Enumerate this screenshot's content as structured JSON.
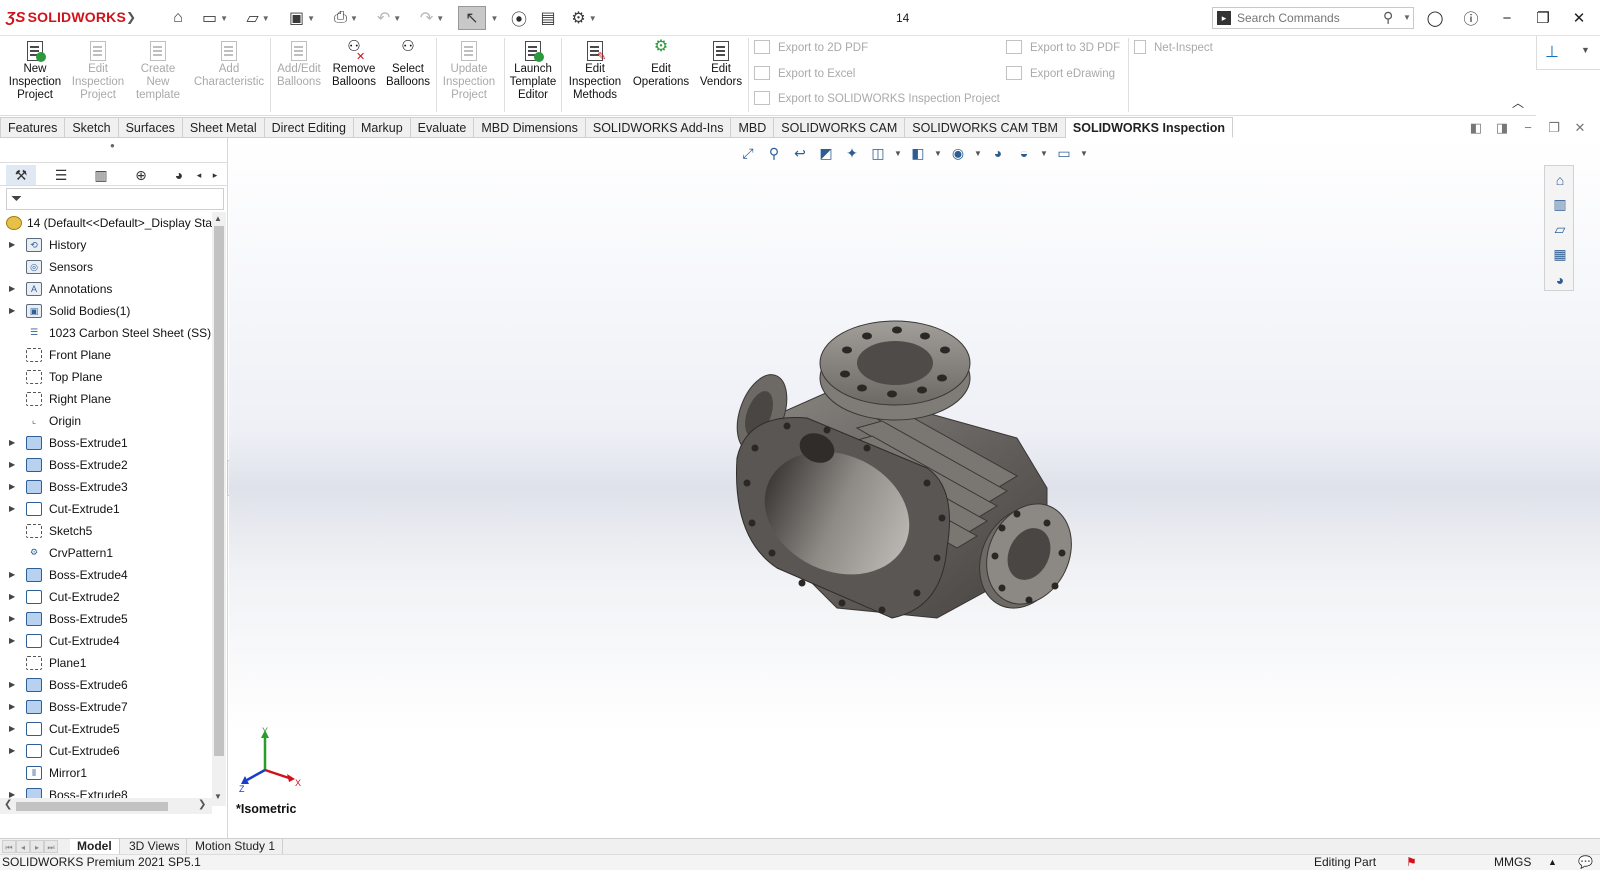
{
  "app": {
    "logo": "SOLIDWORKS",
    "document_title": "14",
    "search_placeholder": "Search Commands"
  },
  "colors": {
    "brand_red": "#d1121b",
    "icon_blue": "#2d5e93",
    "part_gray": "#6f6b67"
  },
  "quick_access": [
    {
      "name": "home-icon",
      "glyph": "⌂"
    },
    {
      "name": "new-document-icon",
      "glyph": "🗋"
    },
    {
      "name": "open-icon",
      "glyph": "📂"
    },
    {
      "name": "save-icon",
      "glyph": "💾"
    },
    {
      "name": "print-icon",
      "glyph": "🖶"
    },
    {
      "name": "undo-icon",
      "glyph": "↶"
    },
    {
      "name": "redo-icon",
      "glyph": "↷"
    },
    {
      "name": "select-icon",
      "glyph": "↖"
    },
    {
      "name": "rebuild-icon",
      "glyph": "🚦"
    },
    {
      "name": "file-properties-icon",
      "glyph": "▤"
    },
    {
      "name": "options-icon",
      "glyph": "⚙"
    }
  ],
  "commands": {
    "new_project": "New\nInspection\nProject",
    "edit_project": "Edit\nInspection\nProject",
    "create_template": "Create\nNew\ntemplate",
    "add_characteristic": "Add\nCharacteristic",
    "add_edit_balloons": "Add/Edit\nBalloons",
    "remove_balloons": "Remove\nBalloons",
    "select_balloons": "Select\nBalloons",
    "update_project": "Update\nInspection\nProject",
    "launch_template": "Launch\nTemplate\nEditor",
    "edit_methods": "Edit\nInspection\nMethods",
    "edit_operations": "Edit\nOperations",
    "edit_vendors": "Edit\nVendors",
    "export_2d_pdf": "Export to 2D PDF",
    "export_excel": "Export to Excel",
    "export_project": "Export to SOLIDWORKS Inspection Project",
    "export_3d_pdf": "Export to 3D PDF",
    "export_edrawing": "Export eDrawing",
    "net_inspect": "Net-Inspect"
  },
  "tabs": [
    "Features",
    "Sketch",
    "Surfaces",
    "Sheet Metal",
    "Direct Editing",
    "Markup",
    "Evaluate",
    "MBD Dimensions",
    "SOLIDWORKS Add-Ins",
    "MBD",
    "SOLIDWORKS CAM",
    "SOLIDWORKS CAM TBM",
    "SOLIDWORKS Inspection"
  ],
  "active_tab": "SOLIDWORKS Inspection",
  "tree": {
    "root": "14  (Default<<Default>_Display Sta",
    "nodes": [
      {
        "label": "History",
        "expandable": true,
        "icon": "history"
      },
      {
        "label": "Sensors",
        "expandable": false,
        "icon": "sensor"
      },
      {
        "label": "Annotations",
        "expandable": true,
        "icon": "annotation"
      },
      {
        "label": "Solid Bodies(1)",
        "expandable": true,
        "icon": "bodies"
      },
      {
        "label": "1023 Carbon Steel Sheet (SS)",
        "expandable": false,
        "icon": "material"
      },
      {
        "label": "Front Plane",
        "expandable": false,
        "icon": "plane"
      },
      {
        "label": "Top Plane",
        "expandable": false,
        "icon": "plane"
      },
      {
        "label": "Right Plane",
        "expandable": false,
        "icon": "plane"
      },
      {
        "label": "Origin",
        "expandable": false,
        "icon": "origin"
      },
      {
        "label": "Boss-Extrude1",
        "expandable": true,
        "icon": "boss"
      },
      {
        "label": "Boss-Extrude2",
        "expandable": true,
        "icon": "boss"
      },
      {
        "label": "Boss-Extrude3",
        "expandable": true,
        "icon": "boss"
      },
      {
        "label": "Cut-Extrude1",
        "expandable": true,
        "icon": "cut"
      },
      {
        "label": "Sketch5",
        "expandable": false,
        "icon": "sketch"
      },
      {
        "label": "CrvPattern1",
        "expandable": false,
        "icon": "pattern"
      },
      {
        "label": "Boss-Extrude4",
        "expandable": true,
        "icon": "boss"
      },
      {
        "label": "Cut-Extrude2",
        "expandable": true,
        "icon": "cut"
      },
      {
        "label": "Boss-Extrude5",
        "expandable": true,
        "icon": "boss"
      },
      {
        "label": "Cut-Extrude4",
        "expandable": true,
        "icon": "cut"
      },
      {
        "label": "Plane1",
        "expandable": false,
        "icon": "plane"
      },
      {
        "label": "Boss-Extrude6",
        "expandable": true,
        "icon": "boss"
      },
      {
        "label": "Boss-Extrude7",
        "expandable": true,
        "icon": "boss"
      },
      {
        "label": "Cut-Extrude5",
        "expandable": true,
        "icon": "cut"
      },
      {
        "label": "Cut-Extrude6",
        "expandable": true,
        "icon": "cut"
      },
      {
        "label": "Mirror1",
        "expandable": false,
        "icon": "mirror"
      },
      {
        "label": "Boss-Extrude8",
        "expandable": true,
        "icon": "boss"
      }
    ]
  },
  "viewport": {
    "view_label": "*Isometric"
  },
  "bottom_tabs": [
    "Model",
    "3D Views",
    "Motion Study 1"
  ],
  "active_bottom_tab": "Model",
  "status": {
    "version": "SOLIDWORKS Premium 2021 SP5.1",
    "mode": "Editing Part",
    "units": "MMGS"
  }
}
